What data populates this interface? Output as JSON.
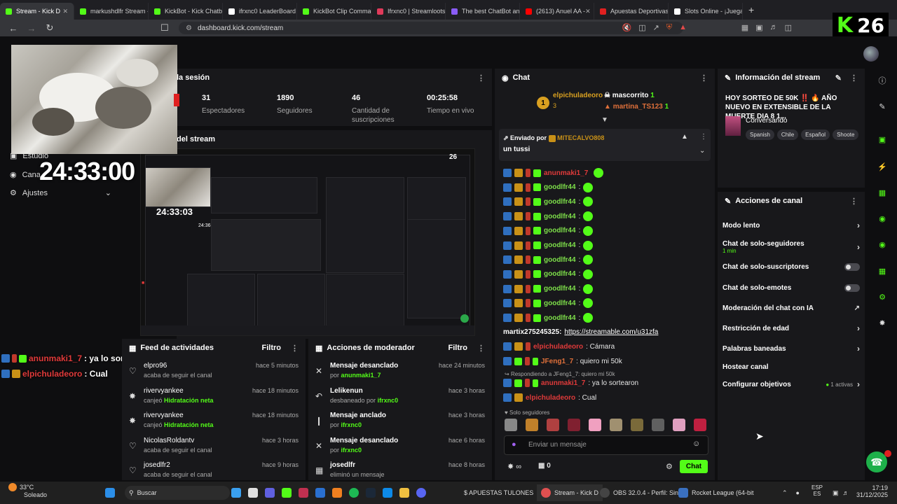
{
  "browser": {
    "tabs": [
      {
        "label": "Stream - Kick D",
        "color": "#53fc18",
        "active": true
      },
      {
        "label": "markushdlfr Stream - V",
        "color": "#53fc18"
      },
      {
        "label": "KickBot - Kick Chatbot",
        "color": "#53fc18"
      },
      {
        "label": "ifrxnc0 LeaderBoard |",
        "color": "#ffffff"
      },
      {
        "label": "KickBot Clip Command",
        "color": "#53fc18"
      },
      {
        "label": "Ifrxnc0 | Streamloots |",
        "color": "#e03a5a"
      },
      {
        "label": "The best ChatBot and",
        "color": "#8a5cf6"
      },
      {
        "label": "(2613) Anuel AA -",
        "color": "#ff0000"
      },
      {
        "label": "Apuestas Deportivas",
        "color": "#e02020"
      },
      {
        "label": "Slots Online - ¡Juega T",
        "color": "#ffffff"
      }
    ],
    "new_tab": "+",
    "url": "dashboard.kick.com/stream",
    "overlay_badge": "26"
  },
  "overlay": {
    "big_timer": "24:33:00",
    "chat": [
      {
        "user": "anunmaki1_7",
        "message": ": ya lo sortearon"
      },
      {
        "user": "elpichuladeoro",
        "message": ": Cual"
      }
    ]
  },
  "left_menu": {
    "items": [
      {
        "label": "Estudio"
      },
      {
        "label": "Cana"
      },
      {
        "label": "Ajustes"
      }
    ]
  },
  "session": {
    "title": "la sesión",
    "stats": [
      {
        "value": "31",
        "label": "Espectadores"
      },
      {
        "value": "1890",
        "label": "Seguidores"
      },
      {
        "value": "46",
        "label": "Cantidad de suscripciones"
      },
      {
        "value": "00:25:58",
        "label": "Tiempo en vivo"
      }
    ]
  },
  "preview": {
    "title": "del stream",
    "inner_timer": "24:33:03",
    "inner_timer2": "24:36:05",
    "inner_badge": "26"
  },
  "feed": {
    "title": "Feed de actividades",
    "filter": "Filtro",
    "items": [
      {
        "user": "elpro96",
        "action": "acaba de seguir el canal",
        "time": "hace 5 minutos",
        "icon": "heart-icon",
        "highlight": false
      },
      {
        "user": "rivervyankee",
        "action": "canjeó",
        "reward": "Hidratación neta",
        "time": "hace 18 minutos",
        "icon": "gift-icon",
        "highlight": true
      },
      {
        "user": "rivervyankee",
        "action": "canjeó",
        "reward": "Hidratación neta",
        "time": "hace 18 minutos",
        "icon": "gift-icon",
        "highlight": true
      },
      {
        "user": "NicolasRoldantv",
        "action": "acaba de seguir el canal",
        "time": "hace 3 horas",
        "icon": "heart-icon",
        "highlight": false
      },
      {
        "user": "josedlfr2",
        "action": "acaba de seguir el canal",
        "time": "hace 9 horas",
        "icon": "heart-icon",
        "highlight": false
      }
    ]
  },
  "mod": {
    "title": "Acciones de moderador",
    "filter": "Filtro",
    "items": [
      {
        "action": "Mensaje desanclado",
        "by_prefix": "por",
        "by": "anunmaki1_7",
        "time": "hace 24 minutos",
        "icon": "unpin-icon"
      },
      {
        "action": "Lelikenun",
        "by_prefix": "desbaneado por",
        "by": "ifrxnc0",
        "time": "hace 3 horas",
        "icon": "undo-icon"
      },
      {
        "action": "Mensaje anclado",
        "by_prefix": "por",
        "by": "ifrxnc0",
        "time": "hace 3 horas",
        "icon": "pin-icon"
      },
      {
        "action": "Mensaje desanclado",
        "by_prefix": "por",
        "by": "ifrxnc0",
        "time": "hace 6 horas",
        "icon": "unpin-icon"
      },
      {
        "action": "josedlfr",
        "by_prefix": "eliminó un mensaje",
        "by": "",
        "time": "hace 8 horas",
        "icon": "trash-icon"
      }
    ]
  },
  "chat": {
    "title": "Chat",
    "leaders": [
      {
        "name": "elpichuladeoro",
        "count": "3"
      },
      {
        "name": "mascorrito",
        "count": "1"
      },
      {
        "name": "martina_TS123",
        "count": "1"
      }
    ],
    "pinned": {
      "prefix": "Enviado por",
      "sender": "MITECALVO808",
      "text": "un tussi"
    },
    "messages": [
      {
        "user": "anunmaki1_7",
        "text": "",
        "color": "red"
      },
      {
        "user": "goodlfr44",
        "text": ":",
        "color": "green"
      },
      {
        "user": "goodlfr44",
        "text": ":",
        "color": "green"
      },
      {
        "user": "goodlfr44",
        "text": ":",
        "color": "green"
      },
      {
        "user": "goodlfr44",
        "text": ":",
        "color": "green"
      },
      {
        "user": "goodlfr44",
        "text": ":",
        "color": "green"
      },
      {
        "user": "goodlfr44",
        "text": ":",
        "color": "green"
      },
      {
        "user": "goodlfr44",
        "text": ":",
        "color": "green"
      },
      {
        "user": "goodlfr44",
        "text": ":",
        "color": "green"
      },
      {
        "user": "goodlfr44",
        "text": ":",
        "color": "green"
      },
      {
        "user": "goodlfr44",
        "text": ":",
        "color": "green"
      }
    ],
    "link_msg": {
      "user": "martix275245325:",
      "link": "https://streamable.com/u31zfa"
    },
    "m1": {
      "user": "elpichuladeoro",
      "text": ": Cámara"
    },
    "m2": {
      "user": "JFeng1_7",
      "text": ": quiero mi 50k"
    },
    "reply_hint": "Respondiendo a JFeng1_7: quiero mi 50k",
    "m3": {
      "user": "anunmaki1_7",
      "text": ": ya lo sortearon"
    },
    "m4": {
      "user": "elpichuladeoro",
      "text": ": Cual"
    },
    "followers_only": "Solo seguidores",
    "input_placeholder": "Enviar un mensaje",
    "points": "0",
    "send": "Chat"
  },
  "stream_info": {
    "title": "Información del stream",
    "stream_title": "HOY SORTEO DE 50K ‼️ 🔥 AÑO NUEVO EN EXTENSIBLE DE LA MUERTE DIA 8 1...",
    "category": "Conversando",
    "tags": [
      "Spanish",
      "Chile",
      "Español",
      "Shoote"
    ]
  },
  "channel_actions": {
    "title": "Acciones de canal",
    "items": [
      {
        "label": "Modo lento",
        "type": "chevron"
      },
      {
        "label": "Chat de solo-seguidores",
        "sub": "1 min",
        "type": "chevron"
      },
      {
        "label": "Chat de solo-suscriptores",
        "type": "toggle"
      },
      {
        "label": "Chat de solo-emotes",
        "type": "toggle"
      },
      {
        "label": "Moderación del chat con IA",
        "type": "external"
      },
      {
        "label": "Restricción de edad",
        "type": "chevron"
      },
      {
        "label": "Palabras baneadas",
        "type": "chevron"
      },
      {
        "label": "Hostear canal",
        "type": "none"
      },
      {
        "label": "Configurar objetivos",
        "sub_right": "1 activas",
        "type": "chevron"
      }
    ]
  },
  "taskbar": {
    "weather_temp": "33°C",
    "weather_desc": "Soleado",
    "search": "Buscar",
    "apps": [
      {
        "label": "$ APUESTAS TULONES"
      },
      {
        "label": "Stream - Kick D"
      },
      {
        "label": "OBS 32.0.4 - Perfil: Sin"
      },
      {
        "label": "Rocket League (64-bit"
      }
    ],
    "lang1": "ESP",
    "lang2": "ES",
    "time": "17:19",
    "date": "31/12/2025"
  }
}
